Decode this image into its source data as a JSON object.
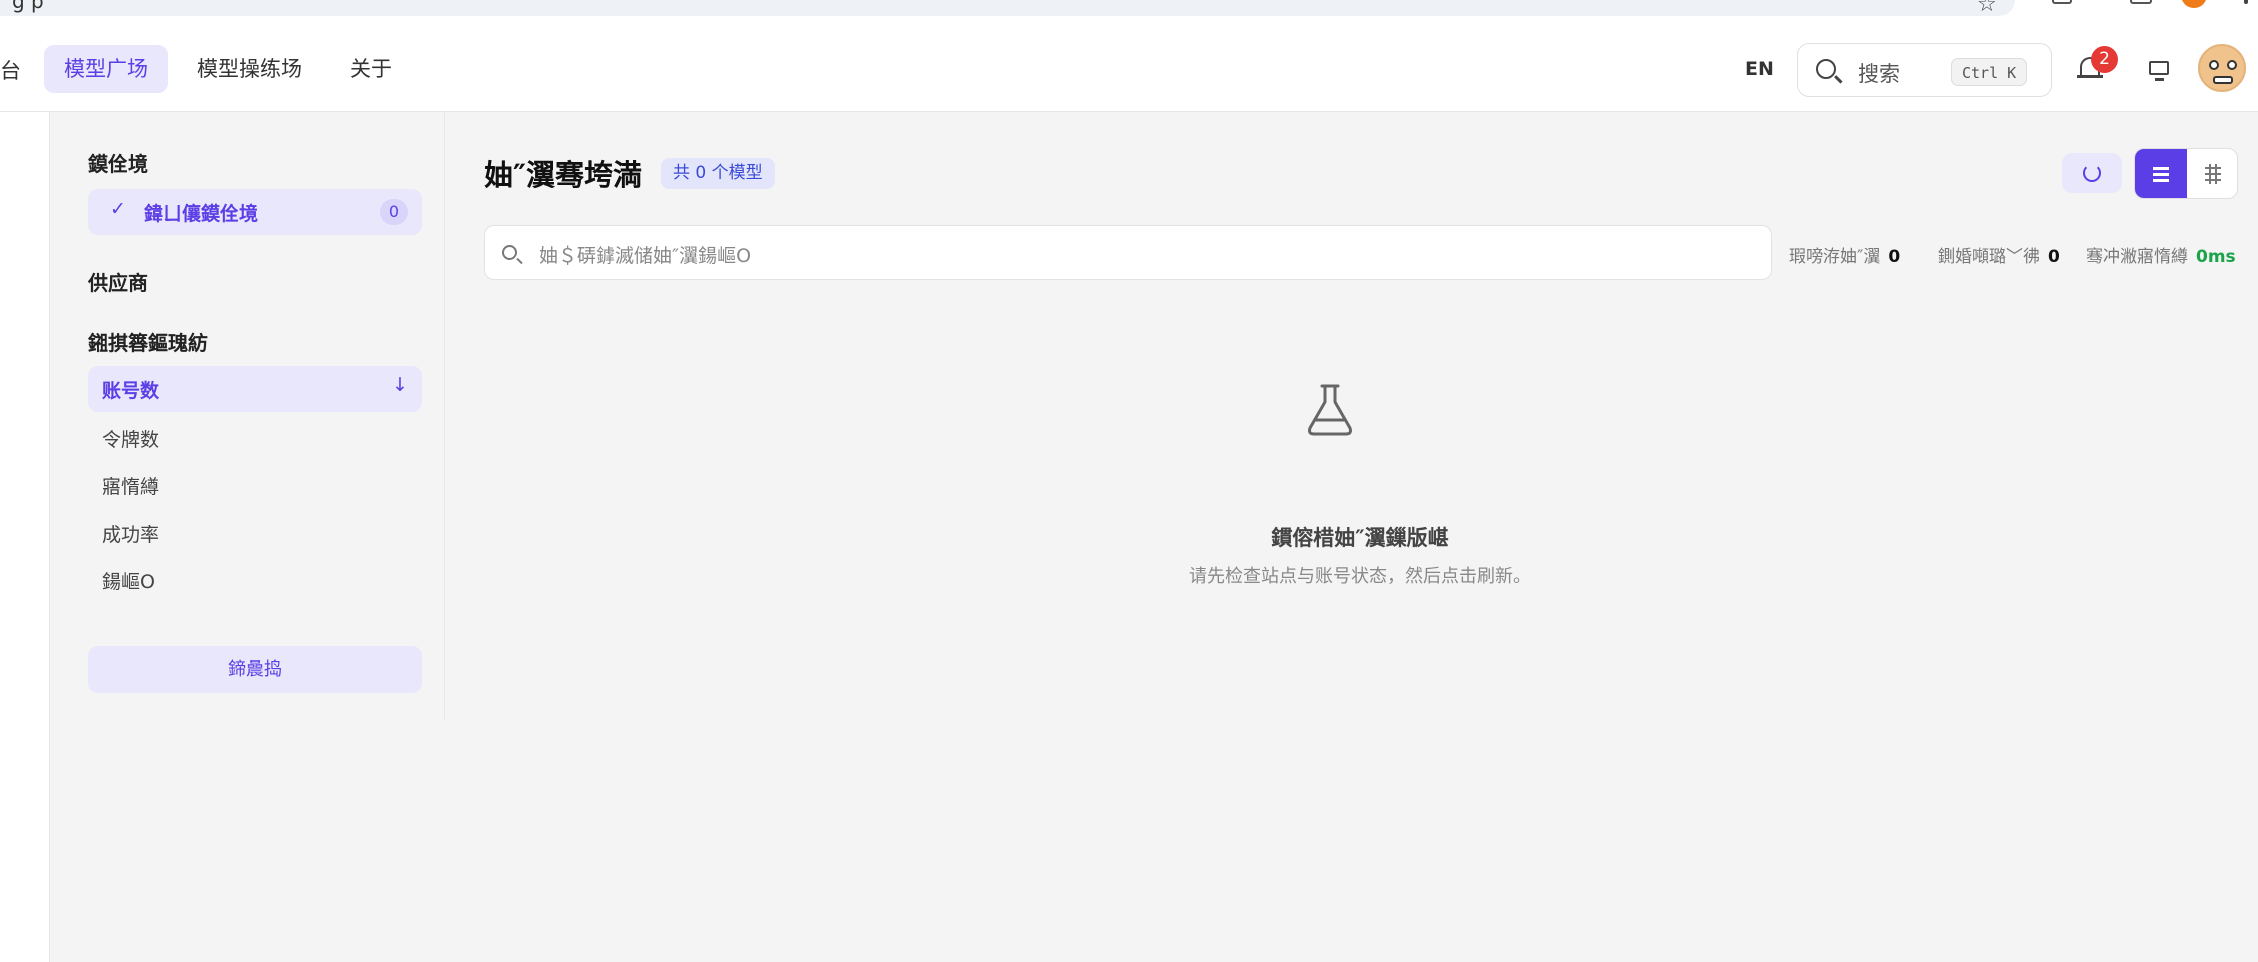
{
  "browser": {
    "url_fragment": "g   p"
  },
  "header": {
    "nav_cut_label": "台",
    "nav_items": [
      {
        "label": "模型广场",
        "active": true
      },
      {
        "label": "模型操练场",
        "active": false
      },
      {
        "label": "关于",
        "active": false
      }
    ],
    "lang_label": "EN",
    "search_label": "搜索",
    "search_shortcut": "Ctrl K",
    "notification_count": "2"
  },
  "sidebar": {
    "section1_title": "鏌佺境",
    "selected_filter": {
      "label": "鍏ㄩ儴鏌佺境",
      "count": "0"
    },
    "provider_title": "供应商",
    "sort_title": "鎺掑簭鏂瑰紡",
    "sort_active": "账号数",
    "sort_items": [
      "令牌数",
      "寤惰繜",
      "成功率",
      "鍚嶇О"
    ],
    "reset_label": "鍗曟捣"
  },
  "main": {
    "title": "妯″瀷骞垮満",
    "count_badge": "共 0 个模型",
    "search_placeholder": "妯＄硦鎼滅储妯″瀷鍚嶇О",
    "stats": [
      {
        "label": "瑕嗙洊妯″瀷",
        "value": "0"
      },
      {
        "label": "鍘婚噸璐﹀彿",
        "value": "0"
      },
      {
        "label": "骞冲潎寤惰繜",
        "value": "0ms"
      }
    ],
    "empty_title": "鏆傛棤妯″瀷鏁版嵁",
    "empty_desc": "请先检查站点与账号状态，然后点击刷新。"
  },
  "colors": {
    "accent": "#5b3ee6",
    "accent_light": "#e9e7fb",
    "badge_red": "#e53935",
    "latency_green": "#1aa34a"
  }
}
